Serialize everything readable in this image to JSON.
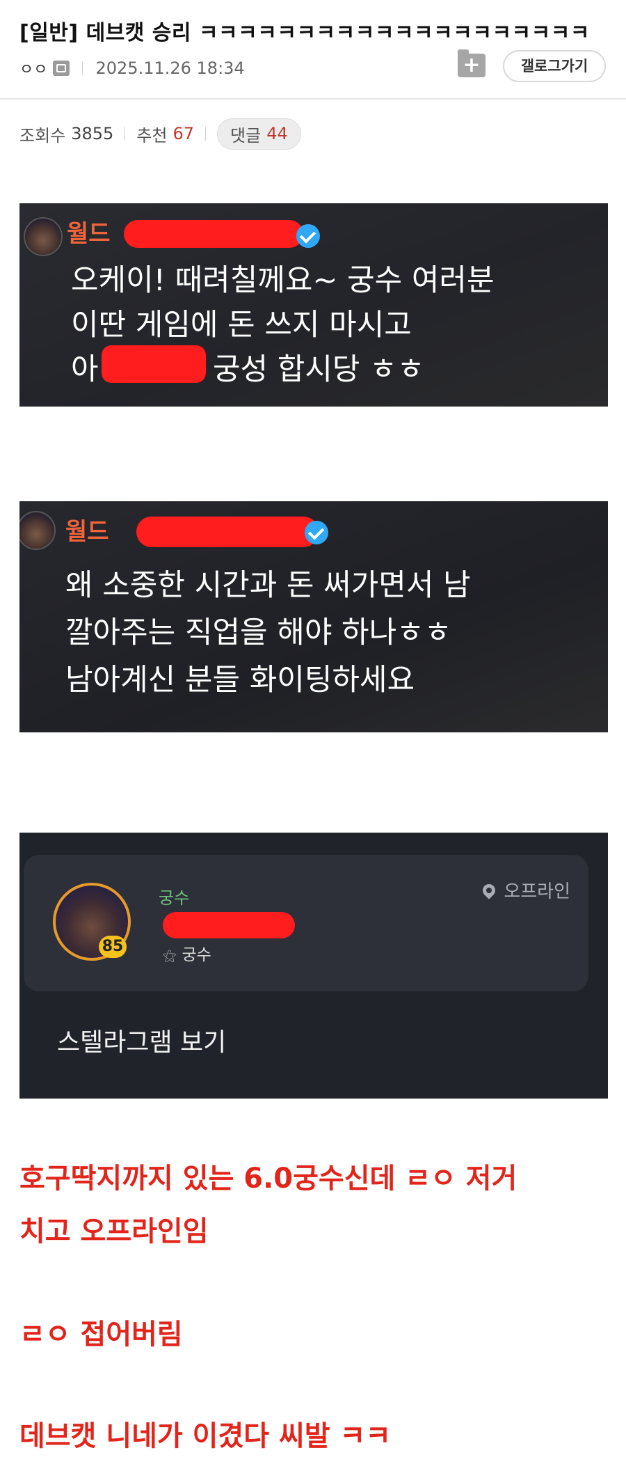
{
  "post": {
    "title": "[일반] 데브캣 승리 ㅋㅋㅋㅋㅋㅋㅋㅋㅋㅋㅋㅋㅋㅋㅋㅋㅋㅋㅋㅋ",
    "writer": "ㅇㅇ",
    "date": "2025.11.26 18:34",
    "folder_add_label": "+",
    "gallog_button_label": "갤로그가기"
  },
  "stats": {
    "views_label": "조회수",
    "views": "3855",
    "recommend_label": "추천",
    "recommend": "67",
    "comments_label": "댓글",
    "comments": "44"
  },
  "screenshot1": {
    "name": "월드",
    "lines": [
      "오케이! 때려칠께요~ 궁수 여러분",
      "이딴 게임에 돈 쓰지 마시고",
      "아",
      "궁성 합시당 ㅎㅎ"
    ]
  },
  "screenshot2": {
    "name": "월드",
    "lines": [
      "왜 소중한 시간과 돈 써가면서 남",
      "깔아주는 직업을 해야 하나ㅎㅎ",
      "남아계신 분들 화이팅하세요"
    ]
  },
  "profile": {
    "class": "궁수",
    "level": "85",
    "sub_class": "궁수",
    "status": "오프라인",
    "stellagram_link": "스텔라그램 보기"
  },
  "body_text": {
    "line1": "호구딱지까지 있는 6.0궁수신데 ㄹㅇ 저거",
    "line2": "치고 오프라인임",
    "line3": "ㄹㅇ 접어버림",
    "line4": "데브캣 니네가 이겼다 씨발 ㅋㅋ"
  },
  "colors": {
    "accent_red": "#e2241a",
    "name_orange": "#f0643c",
    "verified_blue": "#2fa8f5",
    "class_green": "#6dbf7b",
    "level_yellow": "#f6c21c"
  }
}
